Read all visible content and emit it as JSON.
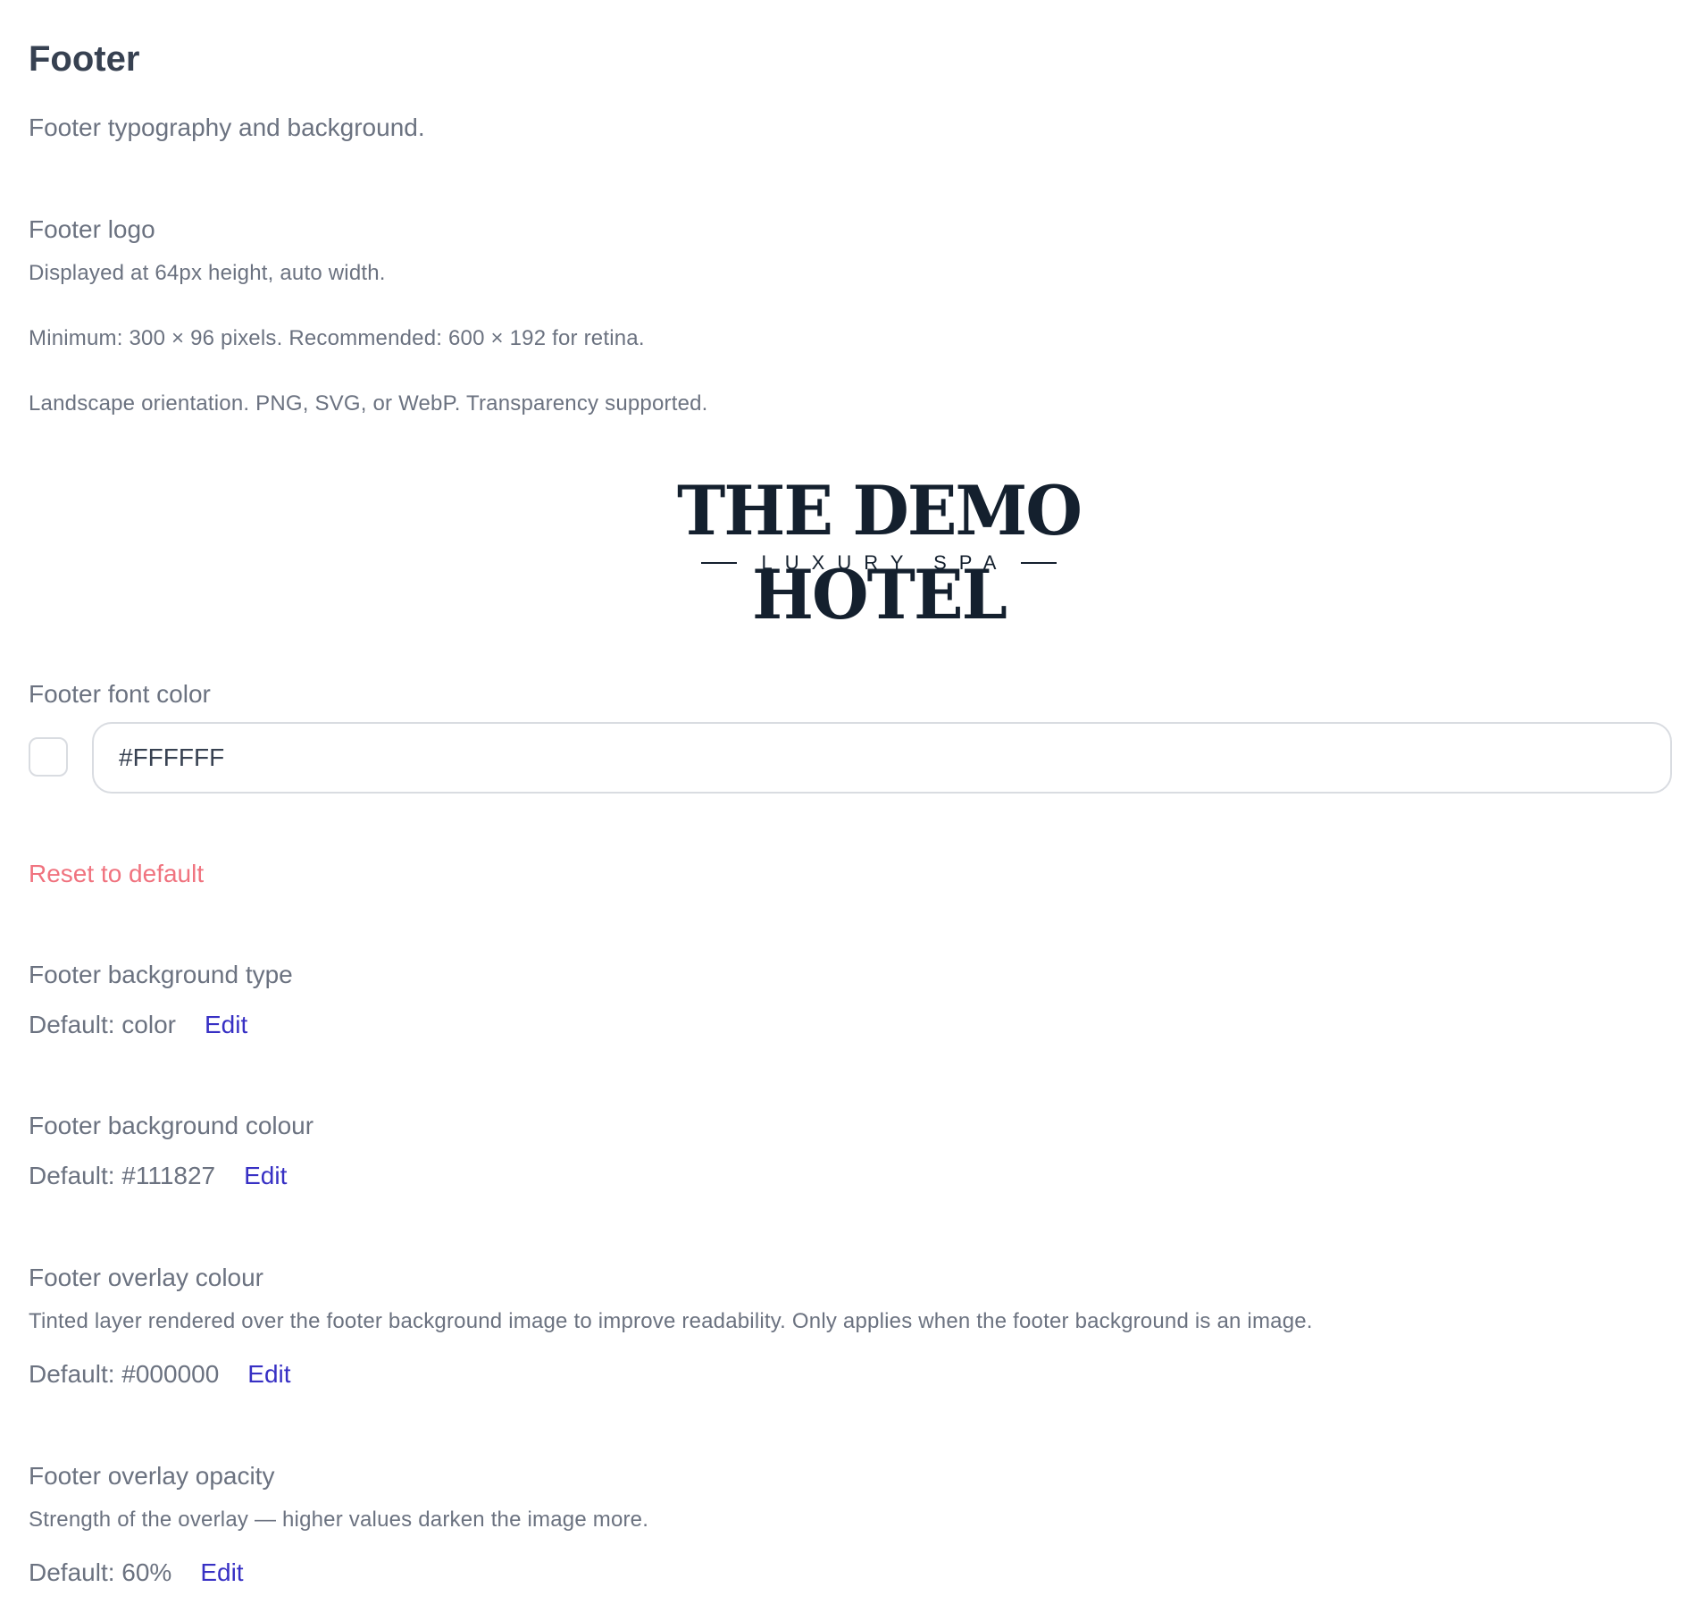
{
  "section": {
    "title": "Footer",
    "subtitle": "Footer typography and background."
  },
  "footer_logo": {
    "label": "Footer logo",
    "help": [
      "Displayed at 64px height, auto width.",
      "Minimum: 300 × 96 pixels. Recommended: 600 × 192 for retina.",
      "Landscape orientation. PNG, SVG, or WebP. Transparency supported."
    ],
    "logo_text": "THE DEMO HOTEL",
    "logo_subtext": "LUXURY SPA"
  },
  "footer_font_color": {
    "label": "Footer font color",
    "value": "#FFFFFF",
    "swatch_color": "#FFFFFF",
    "reset_label": "Reset to default"
  },
  "footer_background_type": {
    "label": "Footer background type",
    "default_text": "Default: color",
    "edit_label": "Edit"
  },
  "footer_background_colour": {
    "label": "Footer background colour",
    "default_text": "Default: #111827",
    "edit_label": "Edit"
  },
  "footer_overlay_colour": {
    "label": "Footer overlay colour",
    "help": "Tinted layer rendered over the footer background image to improve readability. Only applies when the footer background is an image.",
    "default_text": "Default: #000000",
    "edit_label": "Edit"
  },
  "footer_overlay_opacity": {
    "label": "Footer overlay opacity",
    "help": "Strength of the overlay — higher values darken the image more.",
    "default_text": "Default: 60%",
    "edit_label": "Edit"
  },
  "colors": {
    "link": "#3730c4",
    "reset": "#f0737f",
    "logo": "#14202e"
  }
}
